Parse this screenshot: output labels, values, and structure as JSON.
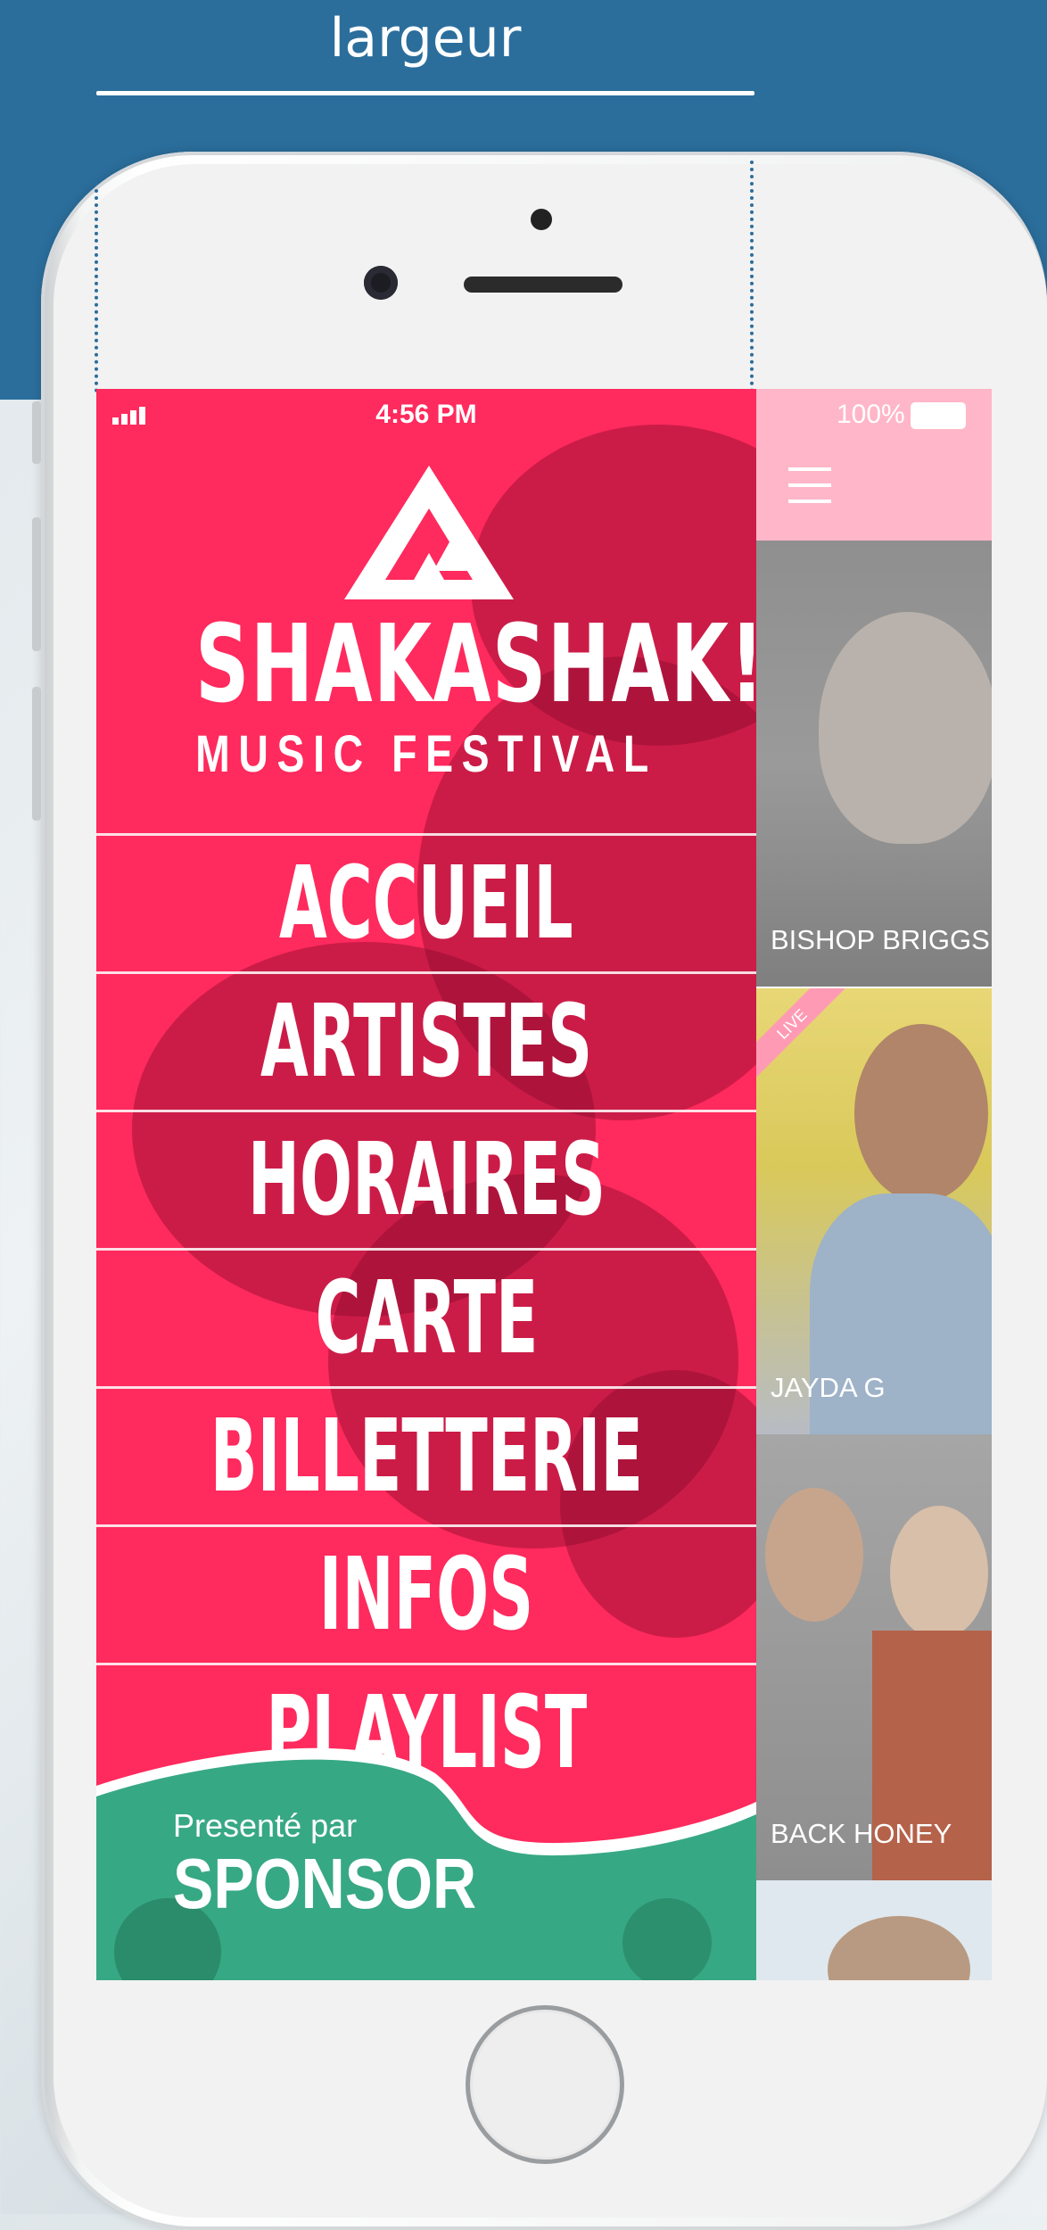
{
  "header": {
    "dimension_label": "largeur"
  },
  "status_bar": {
    "time": "4:56 PM",
    "battery": "100%"
  },
  "menu": {
    "brand": "SHAKASHAK!",
    "subtitle": "MUSIC FESTIVAL",
    "items": [
      {
        "label": "ACCUEIL"
      },
      {
        "label": "ARTISTES"
      },
      {
        "label": "HORAIRES"
      },
      {
        "label": "CARTE"
      },
      {
        "label": "BILLETTERIE"
      },
      {
        "label": "INFOS"
      },
      {
        "label": "PLAYLIST"
      }
    ],
    "sponsor_caption": "Presenté par",
    "sponsor_name": "SPONSOR"
  },
  "artists": [
    {
      "name": "BISHOP BRIGGS"
    },
    {
      "name": "JAYDA G",
      "badge": "LIVE"
    },
    {
      "name": "BACK HONEY"
    }
  ],
  "colors": {
    "menu_bg": "#ff2a5d",
    "sponsor_green": "#37a884",
    "header_blue": "#2b6e9c",
    "content_top": "#ffb6c8"
  },
  "icons": [
    "signal-icon",
    "battery-icon",
    "hamburger-menu-icon",
    "festival-logo-icon"
  ]
}
